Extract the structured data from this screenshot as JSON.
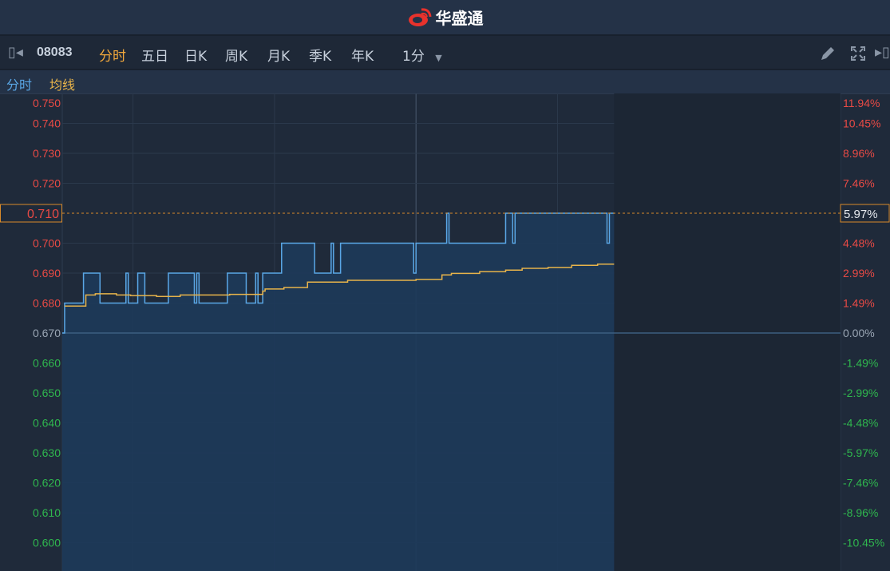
{
  "app": {
    "logo_text": "华盛通",
    "logo_icon": "weibo-eye-icon"
  },
  "toolbar": {
    "code": "08083",
    "tabs": [
      "分时",
      "五日",
      "日K",
      "周K",
      "月K",
      "季K",
      "年K"
    ],
    "active_tab": 0,
    "interval": "1分",
    "icons": [
      "collapse-left-icon",
      "pencil-icon",
      "fullscreen-icon",
      "collapse-right-icon"
    ]
  },
  "legend": {
    "line": "分时",
    "avg": "均线"
  },
  "colors": {
    "price_line": "#5aa7e6",
    "avg_line": "#e7b34a",
    "up": "#e84a45",
    "down": "#2fb64e",
    "flat": "#9aa6b4",
    "highlight": "#d88a2a"
  },
  "chart_data": {
    "type": "line",
    "prev_close": 0.67,
    "ylim": [
      0.6,
      0.75
    ],
    "x_unit": "trading minutes since open (0-330, lunch break at 150)",
    "xlim": [
      0,
      330
    ],
    "left_ticks": [
      "0.750",
      "0.740",
      "0.730",
      "0.720",
      "0.710",
      "0.700",
      "0.690",
      "0.680",
      "0.670",
      "0.660",
      "0.650",
      "0.640",
      "0.630",
      "0.620",
      "0.610",
      "0.600"
    ],
    "left_tick_values": [
      0.75,
      0.74,
      0.73,
      0.72,
      0.71,
      0.7,
      0.69,
      0.68,
      0.67,
      0.66,
      0.65,
      0.64,
      0.63,
      0.62,
      0.61,
      0.6
    ],
    "right_ticks": [
      "11.94%",
      "10.45%",
      "8.96%",
      "7.46%",
      "5.97%",
      "4.48%",
      "2.99%",
      "1.49%",
      "0.00%",
      "-1.49%",
      "-2.99%",
      "-4.48%",
      "-5.97%",
      "-7.46%",
      "-8.96%",
      "-10.45%"
    ],
    "crosshair": {
      "price": "0.710",
      "pct": "5.97%",
      "value": 0.71
    },
    "vertical_grid_minutes": [
      30,
      90,
      150,
      210,
      270
    ],
    "series": [
      {
        "name": "分时",
        "steps": [
          [
            0,
            0.67
          ],
          [
            1,
            0.68
          ],
          [
            9,
            0.69
          ],
          [
            16,
            0.68
          ],
          [
            27,
            0.69
          ],
          [
            28,
            0.68
          ],
          [
            32,
            0.69
          ],
          [
            35,
            0.68
          ],
          [
            45,
            0.69
          ],
          [
            56,
            0.68
          ],
          [
            57,
            0.69
          ],
          [
            58,
            0.68
          ],
          [
            70,
            0.69
          ],
          [
            78,
            0.68
          ],
          [
            82,
            0.69
          ],
          [
            83,
            0.68
          ],
          [
            85,
            0.69
          ],
          [
            93,
            0.7
          ],
          [
            107,
            0.69
          ],
          [
            114,
            0.7
          ],
          [
            115,
            0.69
          ],
          [
            118,
            0.7
          ],
          [
            149,
            0.69
          ],
          [
            150,
            0.7
          ],
          [
            163,
            0.71
          ],
          [
            164,
            0.7
          ],
          [
            188,
            0.71
          ],
          [
            191,
            0.7
          ],
          [
            192,
            0.71
          ],
          [
            231,
            0.7
          ],
          [
            232,
            0.71
          ],
          [
            234,
            0.71
          ]
        ]
      },
      {
        "name": "均线",
        "steps": [
          [
            1,
            0.679
          ],
          [
            10,
            0.6827
          ],
          [
            14,
            0.6831
          ],
          [
            23,
            0.6827
          ],
          [
            29,
            0.6825
          ],
          [
            40,
            0.6822
          ],
          [
            50,
            0.6827
          ],
          [
            71,
            0.6829
          ],
          [
            85,
            0.684
          ],
          [
            86,
            0.6847
          ],
          [
            94,
            0.6852
          ],
          [
            104,
            0.687
          ],
          [
            121,
            0.6876
          ],
          [
            150,
            0.6879
          ],
          [
            161,
            0.6894
          ],
          [
            165,
            0.6899
          ],
          [
            177,
            0.6905
          ],
          [
            188,
            0.691
          ],
          [
            195,
            0.6916
          ],
          [
            206,
            0.6919
          ],
          [
            216,
            0.6926
          ],
          [
            227,
            0.693
          ],
          [
            234,
            0.693
          ]
        ]
      }
    ]
  }
}
